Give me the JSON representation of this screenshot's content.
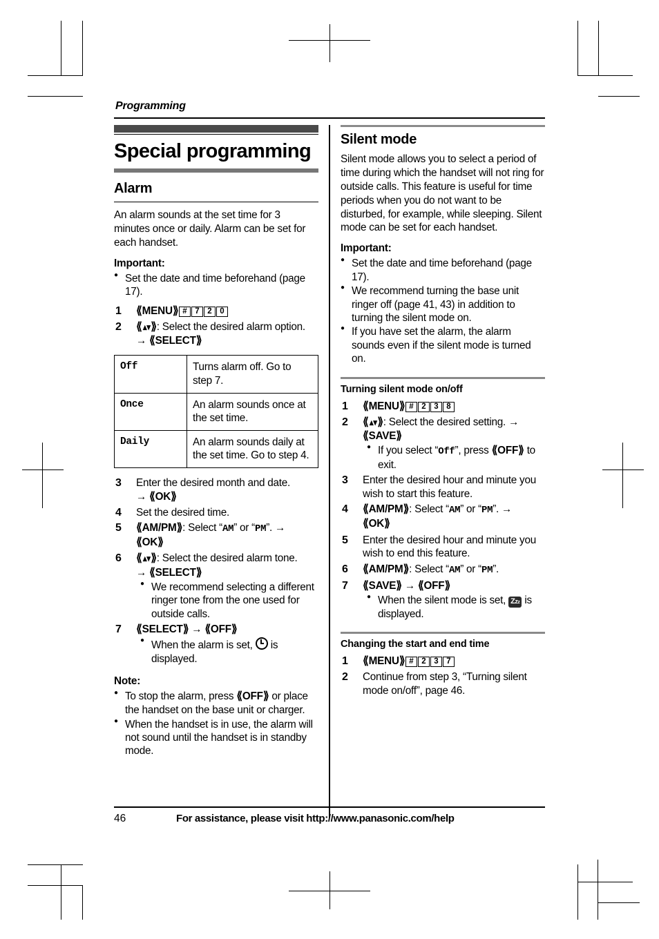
{
  "running_head": "Programming",
  "chapter_title": "Special programming",
  "left_column": {
    "section_title": "Alarm",
    "intro": "An alarm sounds at the set time for 3 minutes once or daily. Alarm can be set for each handset.",
    "important_label": "Important:",
    "important_items": [
      "Set the date and time beforehand (page 17)."
    ],
    "step1_key": "MENU",
    "step1_codes": [
      "#",
      "7",
      "2",
      "0"
    ],
    "step2_text": ": Select the desired alarm option.",
    "step2_arrow_key": "SELECT",
    "table": {
      "rows": [
        {
          "option": "Off",
          "description": "Turns alarm off. Go to step 7."
        },
        {
          "option": "Once",
          "description": "An alarm sounds once at the set time."
        },
        {
          "option": "Daily",
          "description": "An alarm sounds daily at the set time. Go to step 4."
        }
      ]
    },
    "step3_text": "Enter the desired month and date.",
    "step3_arrow_key": "OK",
    "step4_text": "Set the desired time.",
    "step5_key": "AM/PM",
    "step5_text": ": Select “AM” or “PM”.",
    "step5_am": "AM",
    "step5_pm": "PM",
    "step5_arrow_key": "OK",
    "step6_text": ": Select the desired alarm tone.",
    "step6_arrow_key": "SELECT",
    "step6_bullets": [
      "We recommend selecting a different ringer tone from the one used for outside calls."
    ],
    "step7_key_a": "SELECT",
    "step7_key_b": "OFF",
    "step7_bullet_pre": "When the alarm is set,",
    "step7_bullet_post": "is displayed.",
    "note_label": "Note:",
    "note_items": [
      {
        "pre": "To stop the alarm, press",
        "key": "OFF",
        "post": "or place the handset on the base unit or charger."
      },
      {
        "pre": "When the handset is in use, the alarm will not sound until the handset is in standby mode.",
        "key": "",
        "post": ""
      }
    ]
  },
  "right_column": {
    "section_title": "Silent mode",
    "intro": "Silent mode allows you to select a period of time during which the handset will not ring for outside calls. This feature is useful for time periods when you do not want to be disturbed, for example, while sleeping. Silent mode can be set for each handset.",
    "important_label": "Important:",
    "important_items": [
      "Set the date and time beforehand (page 17).",
      "We recommend turning the base unit ringer off (page 41, 43) in addition to turning the silent mode on.",
      "If you have set the alarm, the alarm sounds even if the silent mode is turned on."
    ],
    "sub1_title": "Turning silent mode on/off",
    "sub1_step1_key": "MENU",
    "sub1_step1_codes": [
      "#",
      "2",
      "3",
      "8"
    ],
    "sub1_step2_text": ": Select the desired setting.",
    "sub1_step2_arrow_key": "SAVE",
    "sub1_step2_bullet_pre": "If you select",
    "sub1_step2_bullet_off": "Off",
    "sub1_step2_bullet_mid": ", press",
    "sub1_step2_bullet_key": "OFF",
    "sub1_step2_bullet_post": "to exit.",
    "sub1_step3_text": "Enter the desired hour and minute you wish to start this feature.",
    "sub1_step4_key": "AM/PM",
    "sub1_step4_text": ": Select “AM” or “PM”.",
    "sub1_step4_am": "AM",
    "sub1_step4_pm": "PM",
    "sub1_step4_arrow_key": "OK",
    "sub1_step5_text": "Enter the desired hour and minute you wish to end this feature.",
    "sub1_step6_key": "AM/PM",
    "sub1_step6_text": ": Select “AM” or “PM”.",
    "sub1_step6_am": "AM",
    "sub1_step6_pm": "PM",
    "sub1_step7_key_a": "SAVE",
    "sub1_step7_key_b": "OFF",
    "sub1_step7_bullet_pre": "When the silent mode is set,",
    "sub1_step7_bullet_post": "is displayed.",
    "sub2_title": "Changing the start and end time",
    "sub2_step1_key": "MENU",
    "sub2_step1_codes": [
      "#",
      "2",
      "3",
      "7"
    ],
    "sub2_step2_text": "Continue from step 3, “Turning silent mode on/off”, page 46."
  },
  "footer": {
    "page_number": "46",
    "assistance_text": "For assistance, please visit http://www.panasonic.com/help"
  },
  "icons": {
    "zzz": "zzz-icon",
    "clock": "clock-icon",
    "navigator": "up-down-navigator-key"
  }
}
